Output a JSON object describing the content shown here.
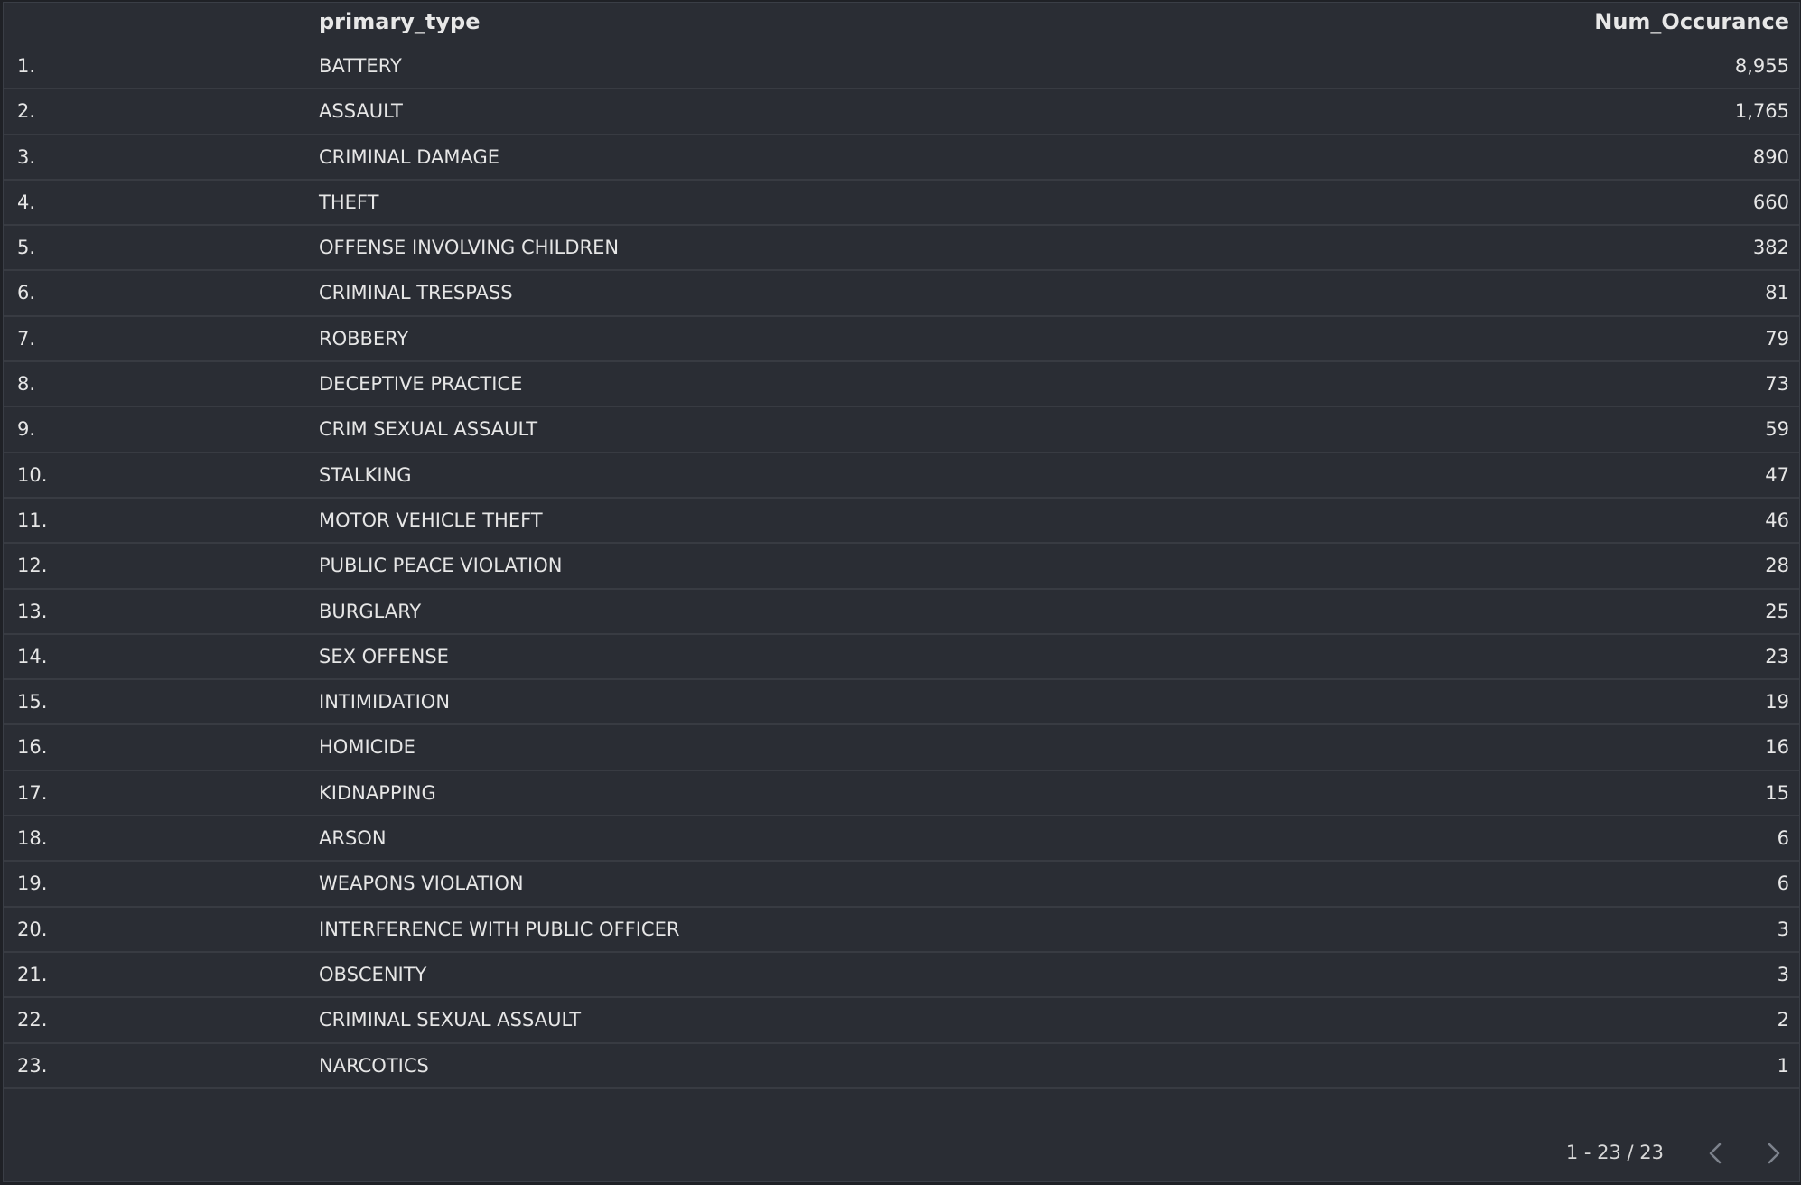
{
  "table": {
    "columns": {
      "type": "primary_type",
      "num": "Num_Occurance"
    },
    "rows": [
      {
        "idx": "1.",
        "type": "BATTERY",
        "num": "8,955"
      },
      {
        "idx": "2.",
        "type": "ASSAULT",
        "num": "1,765"
      },
      {
        "idx": "3.",
        "type": "CRIMINAL DAMAGE",
        "num": "890"
      },
      {
        "idx": "4.",
        "type": "THEFT",
        "num": "660"
      },
      {
        "idx": "5.",
        "type": "OFFENSE INVOLVING CHILDREN",
        "num": "382"
      },
      {
        "idx": "6.",
        "type": "CRIMINAL TRESPASS",
        "num": "81"
      },
      {
        "idx": "7.",
        "type": "ROBBERY",
        "num": "79"
      },
      {
        "idx": "8.",
        "type": "DECEPTIVE PRACTICE",
        "num": "73"
      },
      {
        "idx": "9.",
        "type": "CRIM SEXUAL ASSAULT",
        "num": "59"
      },
      {
        "idx": "10.",
        "type": "STALKING",
        "num": "47"
      },
      {
        "idx": "11.",
        "type": "MOTOR VEHICLE THEFT",
        "num": "46"
      },
      {
        "idx": "12.",
        "type": "PUBLIC PEACE VIOLATION",
        "num": "28"
      },
      {
        "idx": "13.",
        "type": "BURGLARY",
        "num": "25"
      },
      {
        "idx": "14.",
        "type": "SEX OFFENSE",
        "num": "23"
      },
      {
        "idx": "15.",
        "type": "INTIMIDATION",
        "num": "19"
      },
      {
        "idx": "16.",
        "type": "HOMICIDE",
        "num": "16"
      },
      {
        "idx": "17.",
        "type": "KIDNAPPING",
        "num": "15"
      },
      {
        "idx": "18.",
        "type": "ARSON",
        "num": "6"
      },
      {
        "idx": "19.",
        "type": "WEAPONS VIOLATION",
        "num": "6"
      },
      {
        "idx": "20.",
        "type": "INTERFERENCE WITH PUBLIC OFFICER",
        "num": "3"
      },
      {
        "idx": "21.",
        "type": "OBSCENITY",
        "num": "3"
      },
      {
        "idx": "22.",
        "type": "CRIMINAL SEXUAL ASSAULT",
        "num": "2"
      },
      {
        "idx": "23.",
        "type": "NARCOTICS",
        "num": "1"
      }
    ]
  },
  "pagination": {
    "label": "1 - 23 / 23",
    "prev_icon": "chevron-left-icon",
    "next_icon": "chevron-right-icon"
  },
  "colors": {
    "background": "#2a2d34",
    "divider": "#383b42",
    "text": "#e6e6e6"
  }
}
